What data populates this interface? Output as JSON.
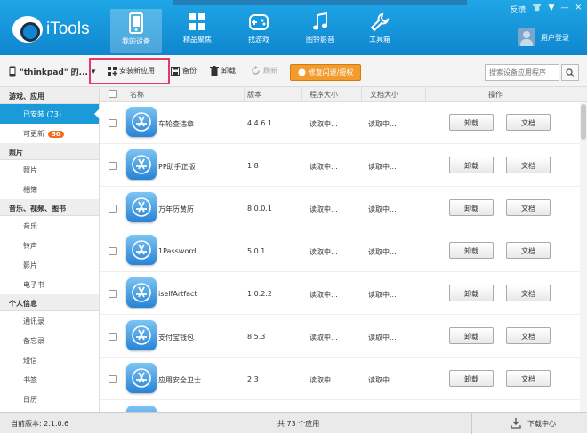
{
  "app": {
    "name": "iTools"
  },
  "window_controls": {
    "feedback": "反馈",
    "shirt": "👕",
    "menu": "▼",
    "minimize": "—",
    "close": "✕"
  },
  "nav": [
    {
      "label": "我的设备",
      "icon": "phone-icon",
      "active": true
    },
    {
      "label": "精品聚焦",
      "icon": "grid-icon"
    },
    {
      "label": "找游戏",
      "icon": "gamepad-icon"
    },
    {
      "label": "图铃影音",
      "icon": "music-icon"
    },
    {
      "label": "工具箱",
      "icon": "wrench-icon"
    }
  ],
  "user": {
    "login": "用户登录"
  },
  "toolbar": {
    "device": "\"thinkpad\" 的...",
    "install": "安装新应用",
    "backup": "备份",
    "uninstall": "卸载",
    "refresh": "刷新",
    "repair": "修复闪退/授权",
    "search_placeholder": "搜索设备应用程序"
  },
  "sidebar": {
    "sections": [
      {
        "title": "游戏、应用",
        "items": [
          {
            "label": "已安装 (73)",
            "active": true
          },
          {
            "label": "可更新",
            "badge": "50"
          }
        ]
      },
      {
        "title": "照片",
        "items": [
          {
            "label": "照片"
          },
          {
            "label": "相簿"
          }
        ]
      },
      {
        "title": "音乐、视频、图书",
        "items": [
          {
            "label": "音乐"
          },
          {
            "label": "铃声"
          },
          {
            "label": "影片"
          },
          {
            "label": "电子书"
          }
        ]
      },
      {
        "title": "个人信息",
        "items": [
          {
            "label": "通讯录"
          },
          {
            "label": "备忘录"
          },
          {
            "label": "短信"
          },
          {
            "label": "书签"
          },
          {
            "label": "日历"
          }
        ]
      }
    ]
  },
  "table": {
    "headers": {
      "name": "名称",
      "version": "版本",
      "program_size": "程序大小",
      "doc_size": "文档大小",
      "action": "操作"
    },
    "rows": [
      {
        "name": "车轮查违章",
        "version": "4.4.6.1",
        "program_size": "读取中...",
        "doc_size": "读取中..."
      },
      {
        "name": "PP助手正版",
        "version": "1.8",
        "program_size": "读取中...",
        "doc_size": "读取中..."
      },
      {
        "name": "万年历黄历",
        "version": "8.0.0.1",
        "program_size": "读取中...",
        "doc_size": "读取中..."
      },
      {
        "name": "1Password",
        "version": "5.0.1",
        "program_size": "读取中...",
        "doc_size": "读取中..."
      },
      {
        "name": "iselfArtfact",
        "version": "1.0.2.2",
        "program_size": "读取中...",
        "doc_size": "读取中..."
      },
      {
        "name": "支付宝钱包",
        "version": "8.5.3",
        "program_size": "读取中...",
        "doc_size": "读取中..."
      },
      {
        "name": "应用安全卫士",
        "version": "2.3",
        "program_size": "读取中...",
        "doc_size": "读取中..."
      }
    ],
    "uninstall_label": "卸载",
    "docs_label": "文档"
  },
  "status": {
    "version": "当前版本: 2.1.0.6",
    "count": "共 73 个应用",
    "download": "下载中心"
  },
  "colors": {
    "accent": "#1a9ad8",
    "header": "#1fa6e6",
    "repair": "#f39c2e",
    "badge": "#f36b1c",
    "highlight": "#e23b6b"
  }
}
